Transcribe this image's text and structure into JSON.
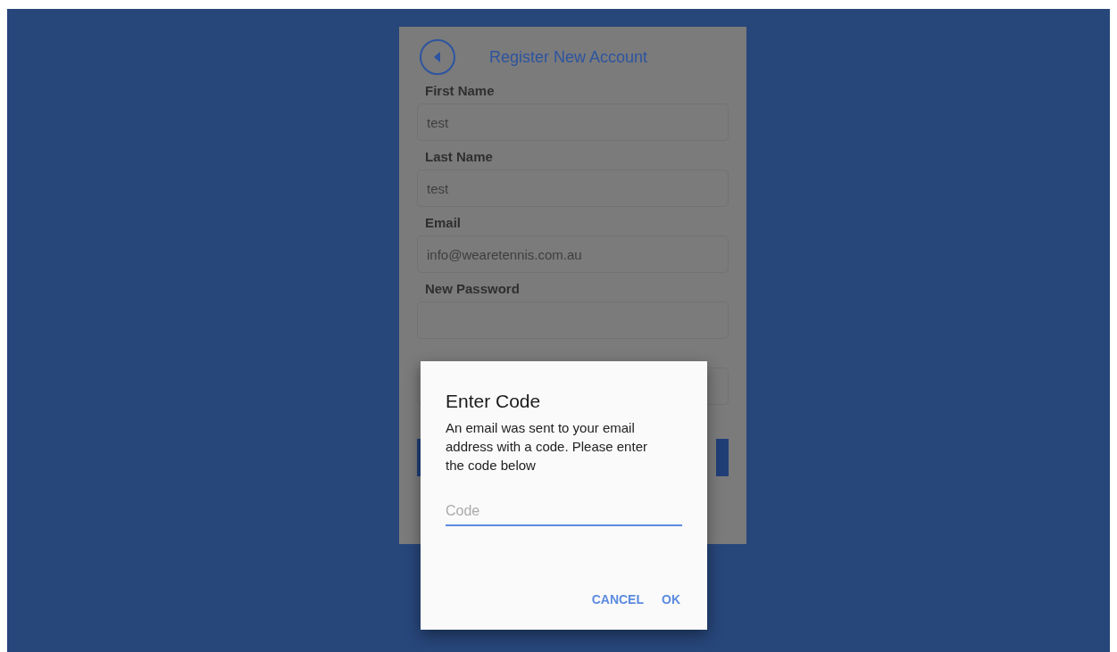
{
  "screen": {
    "title": "Register New Account"
  },
  "fields": [
    {
      "label": "First Name",
      "value": "test"
    },
    {
      "label": "Last Name",
      "value": "test"
    },
    {
      "label": "Email",
      "value": "info@wearetennis.com.au"
    },
    {
      "label": "New Password"
    }
  ],
  "dialog": {
    "title": "Enter Code",
    "message": "An email was sent to your email address with a code. Please enter the code below",
    "code_field": {
      "placeholder": "Code"
    },
    "buttons": [
      "CANCEL",
      "OK"
    ]
  }
}
